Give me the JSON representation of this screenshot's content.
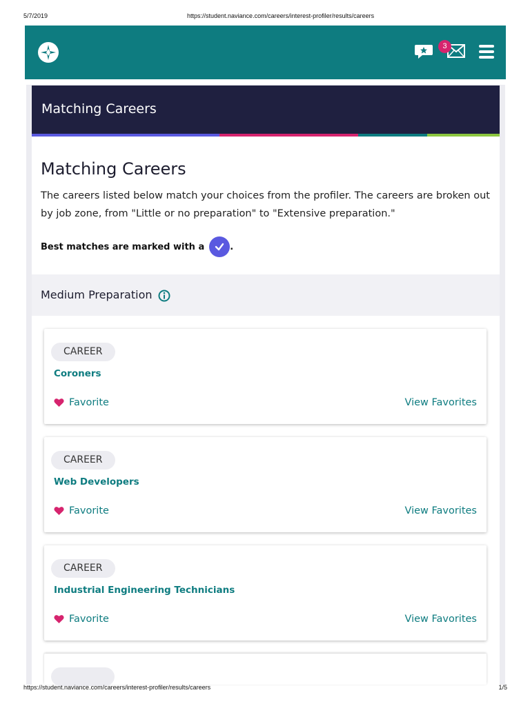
{
  "print": {
    "date": "5/7/2019",
    "url": "https://student.naviance.com/careers/interest-profiler/results/careers",
    "page": "1/5"
  },
  "header": {
    "notification_count": "3",
    "icons": [
      "compass-logo-icon",
      "chat-star-icon",
      "mail-icon",
      "hamburger-menu-icon"
    ],
    "color": "#0e7c80"
  },
  "title_bar": {
    "title": "Matching Careers",
    "color": "#1f2040"
  },
  "color_rule": [
    "#5a59e0",
    "#d6246e",
    "#0e7c80",
    "#8cc63f"
  ],
  "main": {
    "heading": "Matching Careers",
    "intro": "The careers listed below match your choices from the profiler. The careers are broken out by job zone, from \"Little or no preparation\" to \"Extensive preparation.\"",
    "best_matches_text": "Best matches are marked with a",
    "best_matches_period": "."
  },
  "section": {
    "title": "Medium Preparation"
  },
  "cards": [
    {
      "type": "CAREER",
      "name": "Coroners",
      "favorite": "Favorite",
      "view_favorites": "View Favorites"
    },
    {
      "type": "CAREER",
      "name": "Web Developers",
      "favorite": "Favorite",
      "view_favorites": "View Favorites"
    },
    {
      "type": "CAREER",
      "name": "Industrial Engineering Technicians",
      "favorite": "Favorite",
      "view_favorites": "View Favorites"
    }
  ]
}
